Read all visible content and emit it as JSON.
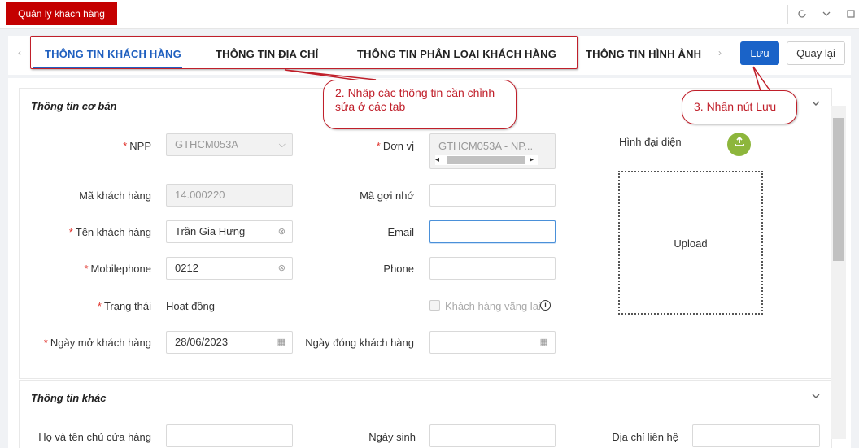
{
  "topbar": {
    "app_tab": "Quản lý khách hàng"
  },
  "tabs": {
    "items": [
      {
        "label": "THÔNG TIN KHÁCH HÀNG",
        "active": true
      },
      {
        "label": "THÔNG TIN ĐỊA CHỈ",
        "active": false
      },
      {
        "label": "THÔNG TIN PHÂN LOẠI KHÁCH HÀNG",
        "active": false
      },
      {
        "label": "THÔNG TIN HÌNH ẢNH",
        "active": false
      }
    ],
    "save_label": "Lưu",
    "back_label": "Quay lại"
  },
  "basic_section": {
    "title": "Thông tin cơ bản",
    "npp": {
      "label": "NPP",
      "value": "GTHCM053A"
    },
    "don_vi": {
      "label": "Đơn vị",
      "value": "GTHCM053A - NP..."
    },
    "ma_khach_hang": {
      "label": "Mã khách hàng",
      "value": "14.000220"
    },
    "ma_goi_nho": {
      "label": "Mã gợi nhớ",
      "value": ""
    },
    "ten_khach_hang": {
      "label": "Tên khách hàng",
      "value": "Trần Gia Hưng"
    },
    "email": {
      "label": "Email",
      "value": ""
    },
    "mobilephone": {
      "label": "Mobilephone",
      "value": "0212"
    },
    "phone": {
      "label": "Phone",
      "value": ""
    },
    "trang_thai": {
      "label": "Trạng thái",
      "value": "Hoạt động"
    },
    "khach_hang_vang_lai": {
      "label": "Khách hàng vãng lai"
    },
    "ngay_mo": {
      "label": "Ngày mở khách hàng",
      "value": "28/06/2023"
    },
    "ngay_dong": {
      "label": "Ngày đóng khách hàng",
      "value": ""
    },
    "avatar": {
      "label": "Hình đại diện",
      "upload_label": "Upload"
    }
  },
  "other_section": {
    "title": "Thông tin khác",
    "owner_name_label": "Họ và tên chủ cửa hàng",
    "birthday_label": "Ngày sinh",
    "contact_address_label": "Địa chỉ liên hệ"
  },
  "annotations": {
    "step2": "2. Nhập các thông tin cần chỉnh sửa ở các tab",
    "step3": "3. Nhấn nút Lưu"
  },
  "colors": {
    "brand_red": "#c40000",
    "primary_blue": "#1a63c8",
    "annotation_red": "#c01f2a",
    "upload_green": "#8db63c"
  }
}
